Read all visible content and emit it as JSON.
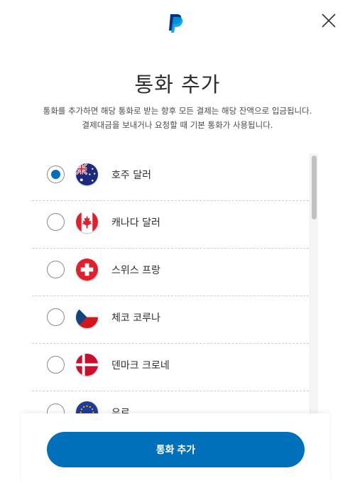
{
  "header": {
    "logo_icon": "paypal-logo-icon",
    "close_icon": "close-icon"
  },
  "title": "통화 추가",
  "description_line1": "통화를 추가하면 해당 통화로 받는 향후 모든 결제는 해당 잔액으로 입금됩니다.",
  "description_line2": "결제대금을 보내거나 요청할 때 기본 통화가 사용됩니다.",
  "currencies": [
    {
      "label": "호주 달러",
      "flag": "australia-flag-icon",
      "selected": true
    },
    {
      "label": "캐나다 달러",
      "flag": "canada-flag-icon",
      "selected": false
    },
    {
      "label": "스위스 프랑",
      "flag": "switzerland-flag-icon",
      "selected": false
    },
    {
      "label": "체코 코루나",
      "flag": "czech-flag-icon",
      "selected": false
    },
    {
      "label": "덴마크 크로네",
      "flag": "denmark-flag-icon",
      "selected": false
    },
    {
      "label": "유로",
      "flag": "eu-flag-icon",
      "selected": false
    }
  ],
  "footer": {
    "add_button_label": "통화 추가"
  },
  "colors": {
    "accent": "#0070ba",
    "paypal_dark": "#003087",
    "paypal_light": "#009cde"
  }
}
